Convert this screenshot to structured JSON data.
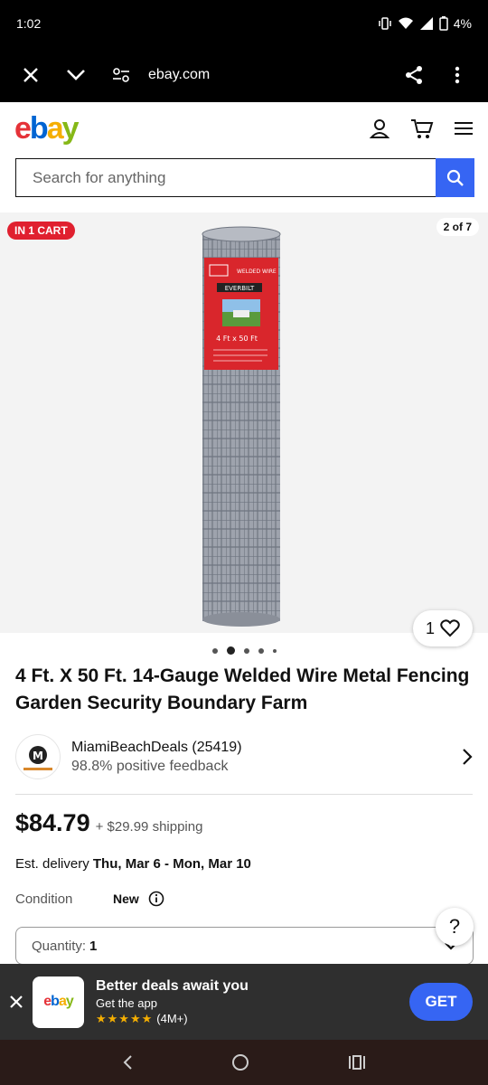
{
  "status_bar": {
    "time": "1:02",
    "battery": "4%"
  },
  "browser": {
    "url": "ebay.com"
  },
  "site": {
    "logo_letters": [
      "e",
      "b",
      "a",
      "y"
    ]
  },
  "search": {
    "placeholder": "Search for anything"
  },
  "gallery": {
    "cart_badge": "IN 1 CART",
    "counter": "2 of 7",
    "watch_count": "1",
    "dots_count": 5,
    "active_dot": 1
  },
  "product": {
    "title": "4 Ft. X 50 Ft. 14-Gauge Welded Wire Metal Fencing Garden Security Boundary Farm",
    "packaging": {
      "brand": "EVERBILT",
      "size": "4 Ft x 50 Ft",
      "small_text": "WELDED WIRE"
    }
  },
  "seller": {
    "name": "MiamiBeachDeals (25419)",
    "feedback": "98.8% positive feedback",
    "avatar_letter": "M"
  },
  "pricing": {
    "price": "$84.79",
    "shipping": "+ $29.99 shipping"
  },
  "delivery": {
    "prefix": "Est. delivery",
    "dates": "Thu, Mar 6 - Mon, Mar 10"
  },
  "condition": {
    "label": "Condition",
    "value": "New"
  },
  "help": {
    "label": "?"
  },
  "quantity": {
    "label": "Quantity:",
    "value": "1"
  },
  "app_banner": {
    "app_name": "ebay",
    "headline": "Better deals await you",
    "subline": "Get the app",
    "stars": "★★★★★",
    "rating_count": "(4M+)",
    "cta": "GET"
  },
  "colors": {
    "accent": "#3665f3",
    "badge_red": "#e0202f",
    "banner_bg": "#2f2f2f"
  }
}
